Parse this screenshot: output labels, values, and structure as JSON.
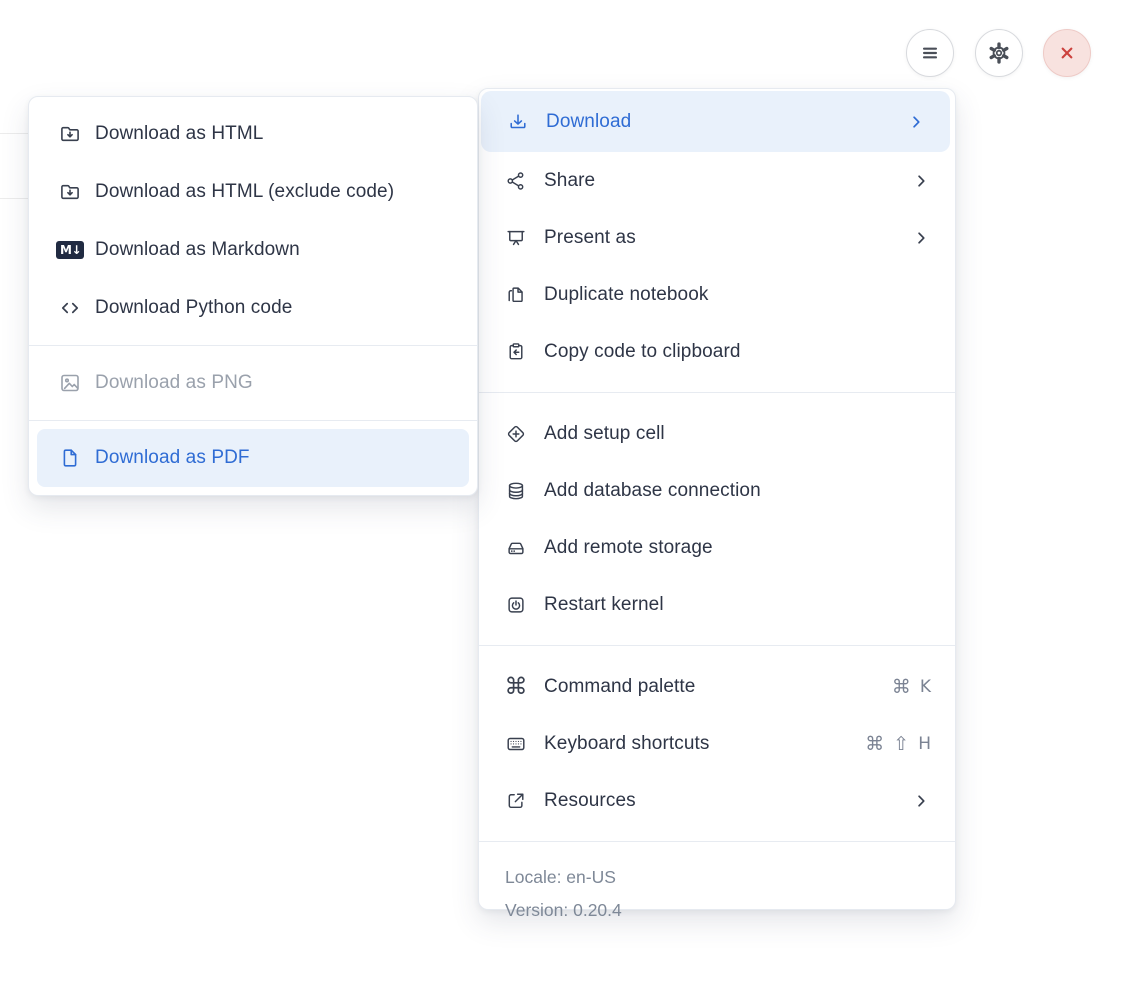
{
  "colors": {
    "accent_blue": "#2f6cd4",
    "highlight_bg": "#e9f1fb",
    "text_dark": "#2e3546",
    "text_disabled": "#9aa1ac",
    "text_muted": "#7e8897",
    "danger_red": "#cc423e",
    "danger_bg": "#f8e2df"
  },
  "topbar": {
    "buttons": [
      {
        "name": "menu",
        "icon": "hamburger-icon"
      },
      {
        "name": "settings",
        "icon": "gear-icon"
      },
      {
        "name": "close",
        "icon": "close-icon"
      }
    ]
  },
  "download_submenu": {
    "items": [
      {
        "label": "Download as HTML",
        "icon": "folder-download-icon",
        "state": "normal"
      },
      {
        "label": "Download as HTML (exclude code)",
        "icon": "folder-download-icon",
        "state": "normal"
      },
      {
        "label": "Download as Markdown",
        "icon": "markdown-badge-icon",
        "badge": "M↓",
        "state": "normal"
      },
      {
        "label": "Download Python code",
        "icon": "code-icon",
        "state": "normal"
      },
      {
        "label": "Download as PNG",
        "icon": "image-icon",
        "state": "disabled"
      },
      {
        "label": "Download as PDF",
        "icon": "file-icon",
        "state": "active"
      }
    ]
  },
  "main_menu": {
    "sections": [
      {
        "items": [
          {
            "label": "Download",
            "icon": "download-icon",
            "state": "active",
            "has_submenu": true
          },
          {
            "label": "Share",
            "icon": "share-icon",
            "has_submenu": true
          },
          {
            "label": "Present as",
            "icon": "presentation-icon",
            "has_submenu": true
          },
          {
            "label": "Duplicate notebook",
            "icon": "duplicate-icon"
          },
          {
            "label": "Copy code to clipboard",
            "icon": "clipboard-arrow-icon"
          }
        ]
      },
      {
        "items": [
          {
            "label": "Add setup cell",
            "icon": "diamond-plus-icon"
          },
          {
            "label": "Add database connection",
            "icon": "database-icon"
          },
          {
            "label": "Add remote storage",
            "icon": "storage-icon"
          },
          {
            "label": "Restart kernel",
            "icon": "power-icon"
          }
        ]
      },
      {
        "items": [
          {
            "label": "Command palette",
            "icon": "command-icon",
            "icon_glyph": "⌘",
            "shortcut": [
              "⌘",
              "K"
            ]
          },
          {
            "label": "Keyboard shortcuts",
            "icon": "keyboard-icon",
            "shortcut": [
              "⌘",
              "⇧",
              "H"
            ]
          },
          {
            "label": "Resources",
            "icon": "external-link-icon",
            "has_submenu": true
          }
        ]
      }
    ],
    "footer": {
      "locale": "Locale: en-US",
      "version": "Version: 0.20.4"
    }
  }
}
